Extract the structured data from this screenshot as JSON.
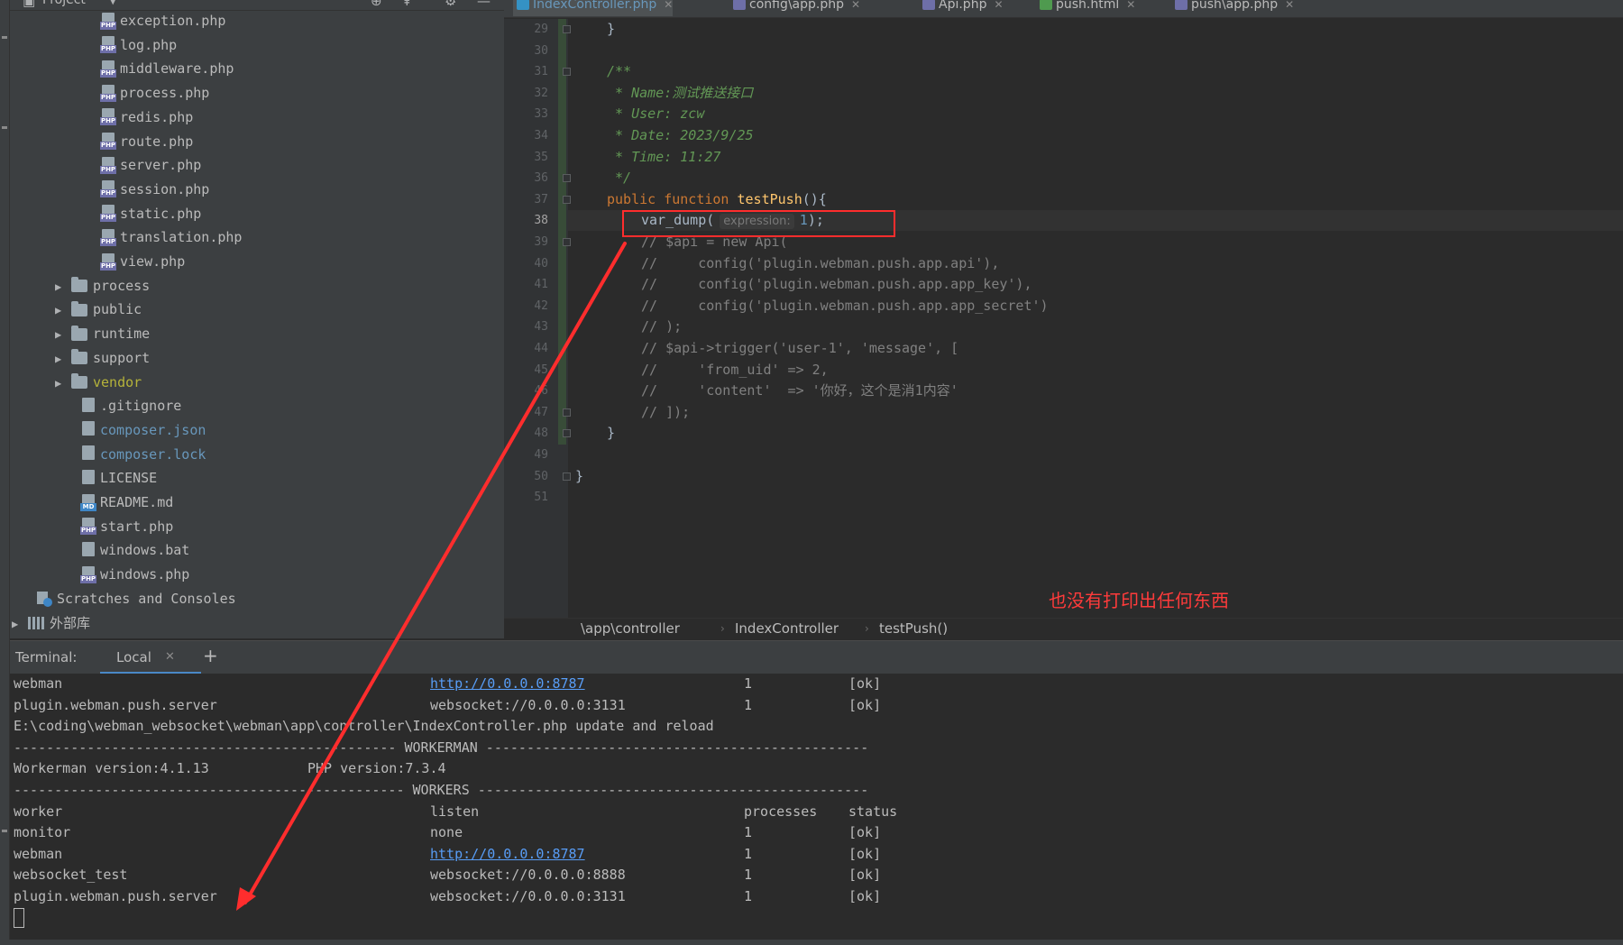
{
  "project_panel": {
    "title": "Project",
    "config_files": [
      "exception.php",
      "log.php",
      "middleware.php",
      "process.php",
      "redis.php",
      "route.php",
      "server.php",
      "session.php",
      "static.php",
      "translation.php",
      "view.php"
    ],
    "folders": [
      "process",
      "public",
      "runtime",
      "support",
      "vendor"
    ],
    "root_files": [
      {
        "name": ".gitignore",
        "badge": ""
      },
      {
        "name": "composer.json",
        "badge": ""
      },
      {
        "name": "composer.lock",
        "badge": ""
      },
      {
        "name": "LICENSE",
        "badge": ""
      },
      {
        "name": "README.md",
        "badge": "MD"
      },
      {
        "name": "start.php",
        "badge": "PHP"
      },
      {
        "name": "windows.bat",
        "badge": ""
      },
      {
        "name": "windows.php",
        "badge": "PHP"
      }
    ],
    "scratches": "Scratches and Consoles",
    "external_libs": "外部库",
    "php_badge": "PHP"
  },
  "editor_tabs": [
    {
      "label": "IndexController.php",
      "active": true,
      "color": "#3592c4"
    },
    {
      "label": "config\\app.php",
      "active": false,
      "color": "#6e6fa8"
    },
    {
      "label": "Api.php",
      "active": false,
      "color": "#6e6fa8"
    },
    {
      "label": "push.html",
      "active": false,
      "color": "#4f9a4f"
    },
    {
      "label": "push\\app.php",
      "active": false,
      "color": "#6e6fa8"
    }
  ],
  "code": {
    "line_numbers": [
      "29",
      "30",
      "31",
      "32",
      "33",
      "34",
      "35",
      "36",
      "37",
      "38",
      "39",
      "40",
      "41",
      "42",
      "43",
      "44",
      "45",
      "46",
      "47",
      "48",
      "49",
      "50",
      "51"
    ],
    "current_line": "38",
    "doc_open": "/**",
    "doc_name": " * Name:测试推送接口",
    "doc_user": " * User: zcw",
    "doc_date": " * Date: 2023/9/25",
    "doc_time": " * Time: 11:27",
    "doc_close": " */",
    "fn_kw": "public function ",
    "fn_name": "testPush",
    "fn_tail": "(){",
    "call": "var_dump(",
    "hint": "expression:",
    "arg": "1",
    "call_tail": ");",
    "comments": [
      "// $api = new Api(",
      "//     config('plugin.webman.push.app.api'),",
      "//     config('plugin.webman.push.app.app_key'),",
      "//     config('plugin.webman.push.app.app_secret')",
      "// );",
      "// $api->trigger('user-1', 'message', [",
      "//     'from_uid' => 2,",
      "//     'content'  => '你好，这个是消1内容'",
      "// ]);"
    ],
    "brace": "}"
  },
  "annotation": "也没有打印出任何东西",
  "breadcrumb": [
    "\\app\\controller",
    "IndexController",
    "testPush()"
  ],
  "terminal": {
    "label": "Terminal:",
    "tab": "Local",
    "add": "+",
    "lines_top": [
      {
        "name": "webman",
        "listen": "http://0.0.0.0:8787",
        "link": true,
        "proc": "1",
        "status": "[ok]"
      },
      {
        "name": "plugin.webman.push.server",
        "listen": "websocket://0.0.0.0:3131",
        "link": false,
        "proc": "1",
        "status": "[ok]"
      }
    ],
    "reload_msg": "E:\\coding\\webman_websocket\\webman\\app\\controller\\IndexController.php update and reload",
    "sep_workerman": "----------------------------------------------- WORKERMAN -----------------------------------------------",
    "wm_version": "Workerman version:4.1.13",
    "php_version": "PHP version:7.3.4",
    "sep_workers": "------------------------------------------------ WORKERS ------------------------------------------------",
    "headers": {
      "worker": "worker",
      "listen": "listen",
      "processes": "processes",
      "status": "status"
    },
    "workers": [
      {
        "name": "monitor",
        "listen": "none",
        "link": false,
        "proc": "1",
        "status": "[ok]"
      },
      {
        "name": "webman",
        "listen": "http://0.0.0.0:8787",
        "link": true,
        "proc": "1",
        "status": "[ok]"
      },
      {
        "name": "websocket_test",
        "listen": "websocket://0.0.0.0:8888",
        "link": false,
        "proc": "1",
        "status": "[ok]"
      },
      {
        "name": "plugin.webman.push.server",
        "listen": "websocket://0.0.0.0:3131",
        "link": false,
        "proc": "1",
        "status": "[ok]"
      }
    ]
  },
  "colors": {
    "annotation_red": "#ff2d2d",
    "link_blue": "#589df6",
    "doc_green": "#629755",
    "keyword_orange": "#cc7832"
  }
}
